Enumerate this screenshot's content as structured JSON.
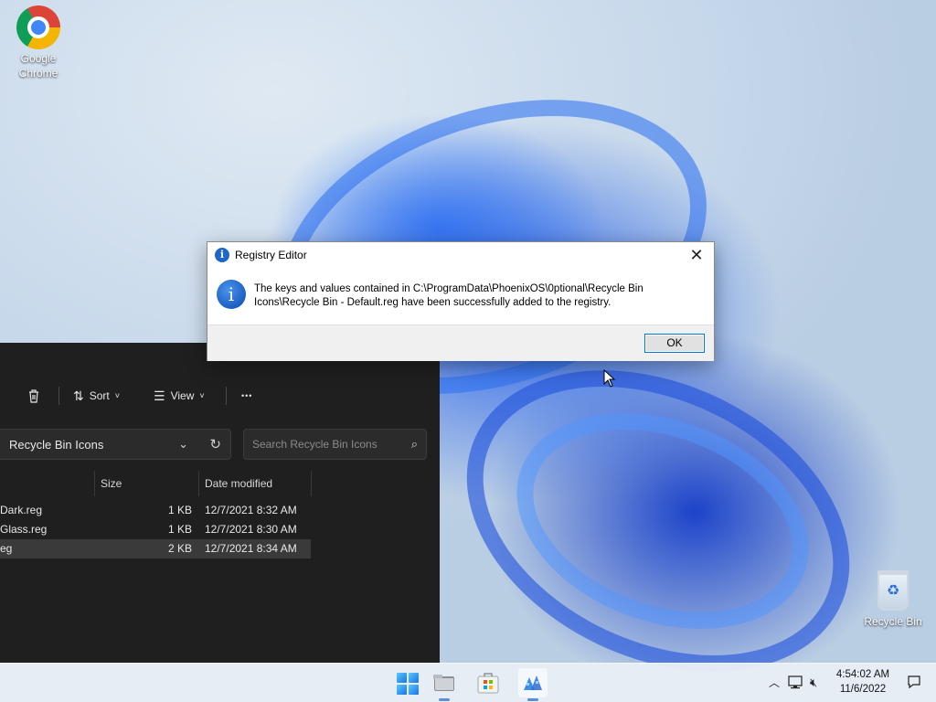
{
  "desktop": {
    "icons": [
      {
        "label": "Google\nChrome"
      },
      {
        "label": "Recycle Bin"
      }
    ]
  },
  "explorer": {
    "toolbar": {
      "sort_label": "Sort",
      "view_label": "View",
      "more_label": "•••"
    },
    "address": {
      "path": "Recycle Bin Icons"
    },
    "search": {
      "placeholder": "Search Recycle Bin Icons"
    },
    "columns": {
      "size": "Size",
      "date_modified": "Date modified"
    },
    "files": [
      {
        "name": "Dark.reg",
        "size": "1 KB",
        "date": "12/7/2021 8:32 AM"
      },
      {
        "name": "Glass.reg",
        "size": "1 KB",
        "date": "12/7/2021 8:30 AM"
      },
      {
        "name": "eg",
        "size": "2 KB",
        "date": "12/7/2021 8:34 AM"
      }
    ]
  },
  "dialog": {
    "title": "Registry Editor",
    "message": "The keys and values contained in C:\\ProgramData\\PhoenixOS\\0ptional\\Recycle Bin Icons\\Recycle Bin - Default.reg have been successfully added to the registry.",
    "ok_label": "OK"
  },
  "taskbar": {
    "clock_time": "4:54:02 AM",
    "clock_date": "11/6/2022"
  }
}
